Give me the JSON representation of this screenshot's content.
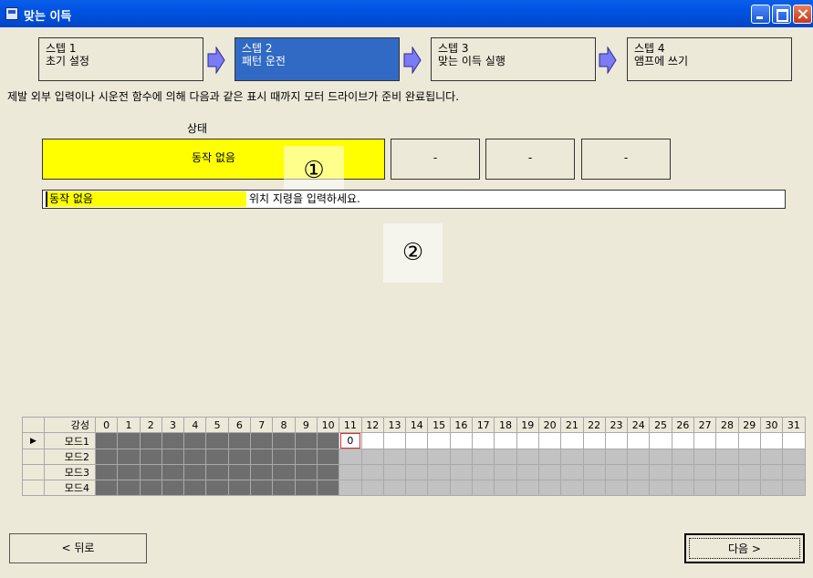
{
  "window": {
    "title": "맞는 이득"
  },
  "steps": [
    {
      "label": "스텝 1",
      "name": "초기 설정"
    },
    {
      "label": "스텝 2",
      "name": "패턴 운전"
    },
    {
      "label": "스텝 3",
      "name": "맞는 이득 실행"
    },
    {
      "label": "스텝 4",
      "name": "앰프에 쓰기"
    }
  ],
  "message": "제발 외부 입력이나 시운전 함수에 의해 다음과 같은 표시 때까지 모터 드라이브가 준비 완료됩니다.",
  "status": {
    "label": "상태",
    "main": "동작 없음",
    "sub": [
      "-",
      "-",
      "-"
    ],
    "marker1": "①",
    "marker2": "②"
  },
  "info": {
    "tag": "동작 없음",
    "text": "위치 지령을 입력하세요."
  },
  "grid": {
    "header_label": "강성",
    "columns": [
      "0",
      "1",
      "2",
      "3",
      "4",
      "5",
      "6",
      "7",
      "8",
      "9",
      "10",
      "11",
      "12",
      "13",
      "14",
      "15",
      "16",
      "17",
      "18",
      "19",
      "20",
      "21",
      "22",
      "23",
      "24",
      "25",
      "26",
      "27",
      "28",
      "29",
      "30",
      "31"
    ],
    "rows": [
      "모드1",
      "모드2",
      "모드3",
      "모드4"
    ],
    "current_row": 0,
    "current_col": 11,
    "current_value": "0"
  },
  "buttons": {
    "back": "< 뒤로",
    "next": "다음 >"
  },
  "colors": {
    "active_step": "#316ac5",
    "status_yellow": "#ffff00",
    "arrow": "#7b7bf7"
  }
}
